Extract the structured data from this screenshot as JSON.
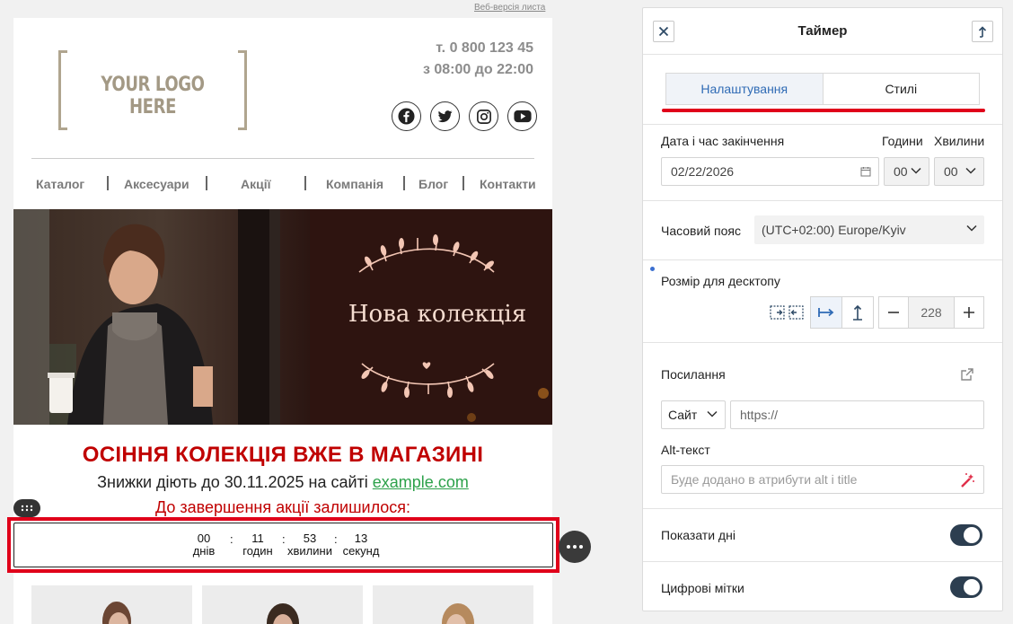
{
  "email": {
    "web_version_link": "Веб-версія листа",
    "logo_text": "YOUR LOGO HERE",
    "phone": "т. 0 800 123 45",
    "hours": "з 08:00 до 22:00",
    "social_icons": [
      "facebook-icon",
      "twitter-icon",
      "instagram-icon",
      "youtube-icon"
    ],
    "nav": [
      "Каталог",
      "Аксесуари",
      "Акції",
      "Компанія",
      "Блог",
      "Контакти"
    ],
    "hero_text": "Нова колекція",
    "headline": "ОСІННЯ КОЛЕКЦІЯ ВЖЕ В МАГАЗИНІ",
    "subline_prefix": "Знижки діють до 30.11.2025 на сайті ",
    "subline_link": "example.com",
    "remaining": "До завершення акції залишилося:",
    "timer": {
      "days": "00",
      "days_label": "днів",
      "hours": "11",
      "hours_label": "годин",
      "minutes": "53",
      "minutes_label": "хвилини",
      "seconds": "13",
      "seconds_label": "секунд",
      "separator": ":"
    },
    "accent_color": "#c00000",
    "link_color": "#2ca14a"
  },
  "panel": {
    "title": "Таймер",
    "tabs": {
      "settings": "Налаштування",
      "styles": "Стилі"
    },
    "end_datetime_label": "Дата і час закінчення",
    "hours_label": "Години",
    "minutes_label": "Хвилини",
    "date_value": "02/22/2026",
    "hours_value": "00",
    "minutes_value": "00",
    "timezone_label": "Часовий пояс",
    "timezone_value": "(UTC+02:00) Europe/Kyiv",
    "desktop_size_label": "Розмір для десктопу",
    "size_value": "228",
    "link_label": "Посилання",
    "link_type": "Сайт",
    "link_placeholder": "https://",
    "alt_label": "Alt-текст",
    "alt_placeholder": "Буде додано в атрибути alt і title",
    "show_days_label": "Показати дні",
    "show_days": true,
    "digital_labels_label": "Цифрові мітки",
    "digital_labels": true,
    "accent_color": "#e0001a",
    "tab_active_color": "#2f6bb5"
  }
}
